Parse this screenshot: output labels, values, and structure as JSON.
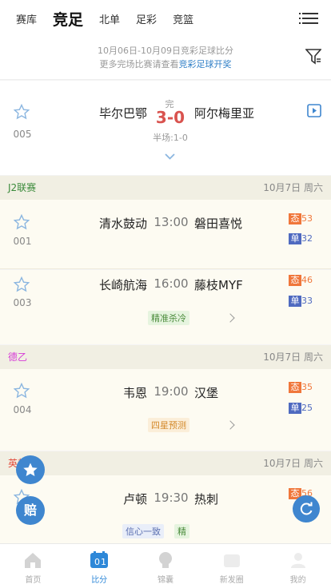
{
  "header": {
    "tabs": [
      "赛库",
      "竞足",
      "北单",
      "足彩",
      "竞篮"
    ]
  },
  "info": {
    "line1": "10月06日-10月09日竞彩足球比分",
    "line2_prefix": "更多完场比赛请查看",
    "line2_link": "竞彩足球开奖"
  },
  "finished": {
    "num": "005",
    "home": "毕尔巴鄂",
    "away": "阿尔梅里亚",
    "status": "完",
    "score": "3-0",
    "halftime": "半场:1-0"
  },
  "leagues": [
    {
      "name": "J2联赛",
      "date": "10月7日 周六",
      "color": "#3a8a3a"
    },
    {
      "name": "德乙",
      "date": "10月7日 周六",
      "color": "#d63bd6"
    },
    {
      "name": "英超",
      "date": "10月7日 周六",
      "color": "#e24a3a"
    }
  ],
  "matches": [
    {
      "num": "001",
      "home": "清水鼓动",
      "time": "13:00",
      "away": "磐田喜悦",
      "tai_label": "态",
      "tai": "53",
      "dan_label": "单",
      "dan": "32",
      "tags": []
    },
    {
      "num": "003",
      "home": "长崎航海",
      "time": "16:00",
      "away": "藤枝MYF",
      "tai_label": "态",
      "tai": "46",
      "dan_label": "单",
      "dan": "33",
      "tags": [
        "精准杀冷"
      ]
    },
    {
      "num": "004",
      "home": "韦恩",
      "time": "19:00",
      "away": "汉堡",
      "tai_label": "态",
      "tai": "35",
      "dan_label": "单",
      "dan": "25",
      "tags": [
        "四星预测"
      ]
    },
    {
      "num": "0",
      "home": "卢顿",
      "time": "19:30",
      "away": "热刺",
      "tai_label": "态",
      "tai": "56",
      "dan_label": "单",
      "dan": "",
      "tags": [
        "信心一致",
        "精"
      ]
    }
  ],
  "floating": {
    "odds_label": "赔"
  },
  "nav": [
    {
      "label": "首页",
      "icon": "home-icon"
    },
    {
      "label": "比分",
      "icon": "score-icon"
    },
    {
      "label": "锦囊",
      "icon": "tips-icon"
    },
    {
      "label": "新发圈",
      "icon": "moments-icon"
    },
    {
      "label": "我的",
      "icon": "profile-icon"
    }
  ],
  "colors": {
    "accent": "#2e88d8",
    "score": "#d9534f",
    "tai": "#f0773b",
    "dan": "#4f6ac0"
  }
}
